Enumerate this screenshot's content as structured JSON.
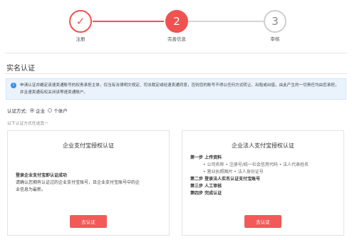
{
  "steps": [
    {
      "num": "✓",
      "label": "注册"
    },
    {
      "num": "2",
      "label": "完善信息"
    },
    {
      "num": "3",
      "label": "审核"
    }
  ],
  "section_title": "实名认证",
  "notice": {
    "icon": "info-icon",
    "text": "申请认证并确定该速卖通账号的权责承担主体，仅当有法律明文规定、司法裁定或经速卖通同意，否则您的账号不得以任何方式转让、出租或出借，由此产生的一切责任均由您承担，并且速卖通有权关闭该等速卖通账户。"
  },
  "auth_mode": {
    "label": "认证方式:",
    "options": [
      "企业",
      "个体户"
    ]
  },
  "hint": "以下认证方式任选其一",
  "cards": {
    "left": {
      "title": "企业支付宝授权认证",
      "line1": "登录企业支付宝即认证成功",
      "line2": "请确认您拥有认证过的企业支付宝账号，且企业支付宝账号中的企",
      "line3": "业信息为最新。",
      "button": "去认证"
    },
    "right": {
      "title": "企业法人支付宝授权认证",
      "step1": "第一步 上传资料",
      "step1_sub1": "• 公司名称 • 注册号/统一社会信用代码 • 法人代表姓名",
      "step1_sub2": "• 营业执照图片 • 法人身份证号",
      "step2": "第二步 登录法人实名认证支付宝账号",
      "step3": "第三步 人工审核",
      "step4": "第四步 完成认证",
      "button": "去认证"
    }
  }
}
